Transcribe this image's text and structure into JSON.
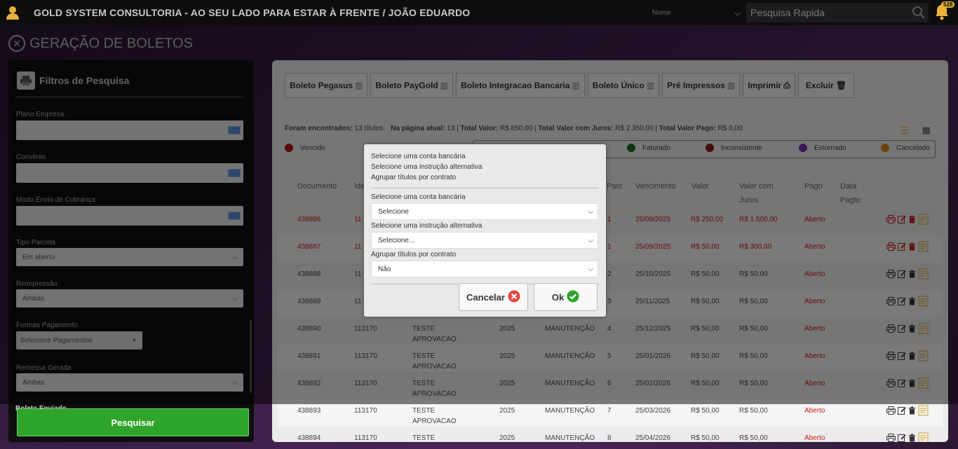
{
  "header": {
    "app_title": "GOLD SYSTEM CONSULTORIA - AO SEU LADO PARA ESTAR À FRENTE / JOÃO EDUARDO",
    "search_type": "Nome",
    "search_placeholder": "Pesquisa Rapida",
    "notification_count": "528"
  },
  "page": {
    "title": "GERAÇÃO DE BOLETOS"
  },
  "filters": {
    "title": "Filtros de Pesquisa",
    "plano_empresa_label": "Plano Empresa",
    "convenio_label": "Convênio",
    "modo_envio_label": "Modo Envio de Cobrança",
    "tipo_parcela_label": "Tipo Parcela",
    "tipo_parcela_value": "Em aberto",
    "reimpressao_label": "Reimpressão",
    "reimpressao_value": "Ambas",
    "formas_pagamento_label": "Formas Pagamento",
    "formas_pagamento_value": "Selecione Pagamentos",
    "remessa_label": "Remessa Gerada",
    "remessa_value": "Ambas",
    "next_label": "Boleto Enviado",
    "search_button": "Pesquisar"
  },
  "toolbar": {
    "b1": "Boleto Pegasus",
    "b2": "Boleto PayGold",
    "b3": "Boleto Integracao Bancaria",
    "b4": "Boleto Único",
    "b5": "Pré Impressos",
    "b6": "Imprimir",
    "b7": "Excluir"
  },
  "summary": {
    "found_label": "Foram encontrados:",
    "found_value": "13 títulos.",
    "page_label": "Na página atual:",
    "page_value": "13",
    "total_label": "Total Valor:",
    "total_value": "R$ 850,00",
    "total_juros_label": "Total Valor com Juros:",
    "total_juros_value": "R$ 2.350,00",
    "total_pago_label": "Total Valor Pago:",
    "total_pago_value": "R$ 0,00"
  },
  "legend": {
    "vencido": "Vencido",
    "faturado": "Faturado",
    "inconsistente": "Inconsistente",
    "estornado": "Estornado",
    "cancelado": "Cancelado",
    "colors": {
      "vencido": "#b8141e",
      "faturado": "#1f6b1f",
      "inconsistente": "#8b1a1a",
      "estornado": "#7a2aa8",
      "cancelado": "#d98a1a"
    }
  },
  "table": {
    "headers": {
      "documento": "Documento",
      "id": "Ide",
      "parc": "Parc",
      "vencimento": "Vencimento",
      "valor": "Valor",
      "valor_juros_1": "Valor com",
      "valor_juros_2": "Juros",
      "pago": "Pago",
      "data_pagto_1": "Data",
      "data_pagto_2": "Pagto"
    },
    "rows": [
      {
        "doc": "438886",
        "id": "11",
        "cliente1": "",
        "cliente2": "",
        "ano": "",
        "tipo": "",
        "parc": "1",
        "venc": "25/09/2025",
        "valor": "R$ 250,00",
        "juros": "R$ 1.500,00",
        "pago": "Aberto"
      },
      {
        "doc": "438887",
        "id": "11",
        "cliente1": "",
        "cliente2": "",
        "ano": "",
        "tipo": "",
        "parc": "1",
        "venc": "25/09/2025",
        "valor": "R$ 50,00",
        "juros": "R$ 300,00",
        "pago": "Aberto"
      },
      {
        "doc": "438888",
        "id": "11",
        "cliente1": "",
        "cliente2": "",
        "ano": "",
        "tipo": "",
        "parc": "2",
        "venc": "25/10/2025",
        "valor": "R$ 50,00",
        "juros": "R$ 50,00",
        "pago": "Aberto"
      },
      {
        "doc": "438889",
        "id": "11",
        "cliente1": "",
        "cliente2": "",
        "ano": "",
        "tipo": "",
        "parc": "3",
        "venc": "25/11/2025",
        "valor": "R$ 50,00",
        "juros": "R$ 50,00",
        "pago": "Aberto"
      },
      {
        "doc": "438890",
        "id": "113170",
        "cliente1": "TESTE",
        "cliente2": "APROVACAO",
        "ano": "2025",
        "tipo": "MANUTENÇÃO",
        "parc": "4",
        "venc": "25/12/2025",
        "valor": "R$ 50,00",
        "juros": "R$ 50,00",
        "pago": "Aberto"
      },
      {
        "doc": "438891",
        "id": "113170",
        "cliente1": "TESTE",
        "cliente2": "APROVACAO",
        "ano": "2025",
        "tipo": "MANUTENÇÃO",
        "parc": "5",
        "venc": "25/01/2026",
        "valor": "R$ 50,00",
        "juros": "R$ 50,00",
        "pago": "Aberto"
      },
      {
        "doc": "438892",
        "id": "113170",
        "cliente1": "TESTE",
        "cliente2": "APROVACAO",
        "ano": "2025",
        "tipo": "MANUTENÇÃO",
        "parc": "6",
        "venc": "25/02/2026",
        "valor": "R$ 50,00",
        "juros": "R$ 50,00",
        "pago": "Aberto"
      },
      {
        "doc": "438893",
        "id": "113170",
        "cliente1": "TESTE",
        "cliente2": "APROVACAO",
        "ano": "2025",
        "tipo": "MANUTENÇÃO",
        "parc": "7",
        "venc": "25/03/2026",
        "valor": "R$ 50,00",
        "juros": "R$ 50,00",
        "pago": "Aberto"
      },
      {
        "doc": "438894",
        "id": "113170",
        "cliente1": "TESTE",
        "cliente2": "",
        "ano": "2025",
        "tipo": "MANUTENÇÃO",
        "parc": "8",
        "venc": "25/04/2026",
        "valor": "R$ 50,00",
        "juros": "R$ 50,00",
        "pago": "Aberto"
      }
    ]
  },
  "modal": {
    "info1": "Selecione uma conta bancária",
    "info2": "Selecione uma instrução alternativa",
    "info3": "Agrupar títulos por contrato",
    "conta_label": "Selecione uma conta bancária",
    "conta_value": "Selecione",
    "instrucao_label": "Selecione uma instrução alternativa",
    "instrucao_value": "Selecione...",
    "agrupar_label": "Agrupar títulos por contrato",
    "agrupar_value": "Não",
    "cancel_button": "Cancelar",
    "ok_button": "Ok"
  }
}
